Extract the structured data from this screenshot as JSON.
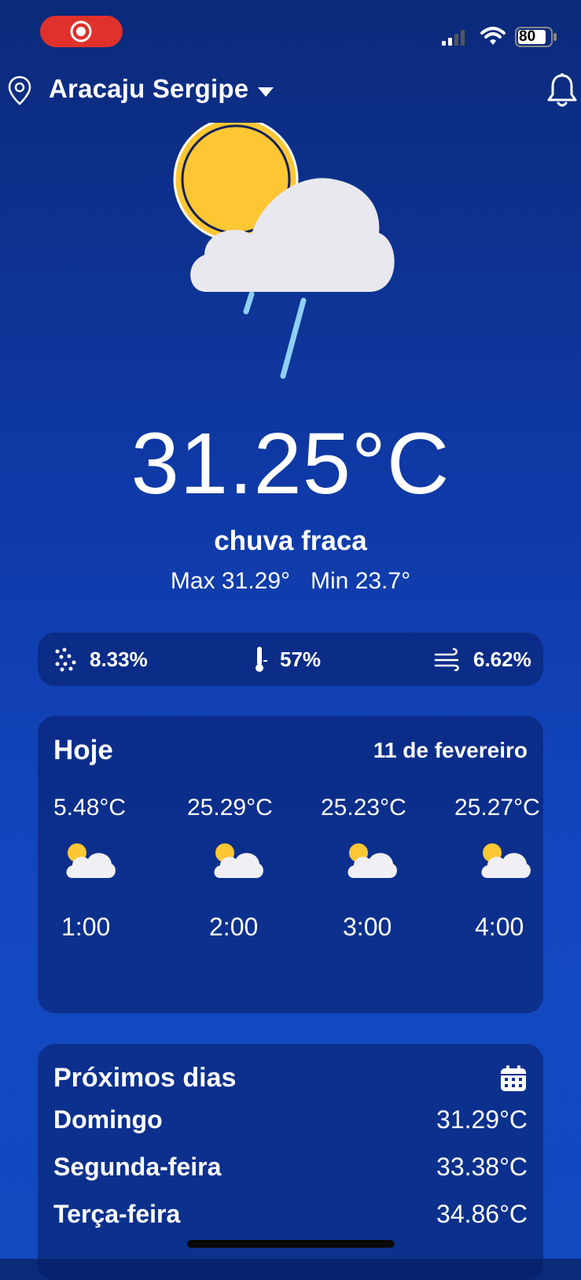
{
  "status_bar": {
    "battery": "80"
  },
  "header": {
    "location": "Aracaju Sergipe"
  },
  "current": {
    "temperature": "31.25°C",
    "description": "chuva fraca",
    "max": "Max 31.29°",
    "min": "Min 23.7°"
  },
  "stats": {
    "rain": "8.33%",
    "humidity": "57%",
    "wind": "6.62%"
  },
  "today": {
    "title": "Hoje",
    "date": "11 de fevereiro",
    "hours": [
      {
        "temp": "5.48°C",
        "time": "1:00",
        "icon": "partly-cloudy-icon"
      },
      {
        "temp": "25.29°C",
        "time": "2:00",
        "icon": "partly-cloudy-icon"
      },
      {
        "temp": "25.23°C",
        "time": "3:00",
        "icon": "partly-cloudy-icon"
      },
      {
        "temp": "25.27°C",
        "time": "4:00",
        "icon": "partly-cloudy-icon"
      }
    ]
  },
  "next_days": {
    "title": "Próximos dias",
    "days": [
      {
        "name": "Domingo",
        "temp": "31.29°C"
      },
      {
        "name": "Segunda-feira",
        "temp": "33.38°C"
      },
      {
        "name": "Terça-feira",
        "temp": "34.86°C"
      }
    ]
  },
  "colors": {
    "accent_red": "#e0312b",
    "sun": "#fcc733",
    "cloud": "#e8e8ee",
    "rain": "#8fd0f5"
  }
}
